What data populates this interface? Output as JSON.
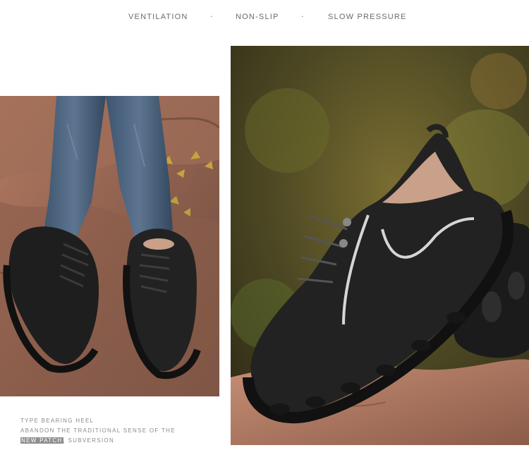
{
  "features": {
    "items": [
      "VENTILATION",
      "NON-SLIP",
      "SLOW PRESSURE"
    ],
    "separator": "·"
  },
  "caption": {
    "line1": "TYPE BEARING HEEL",
    "line2": "ABANDON THE TRADITIONAL SENSE OF THE",
    "line3_highlight": "NEW PATCH",
    "line3_rest": ", SUBVERSION"
  },
  "colors": {
    "shoe": "#1e1e1e",
    "rock": "#9a6a55",
    "background_green": "#6a6a2a"
  }
}
